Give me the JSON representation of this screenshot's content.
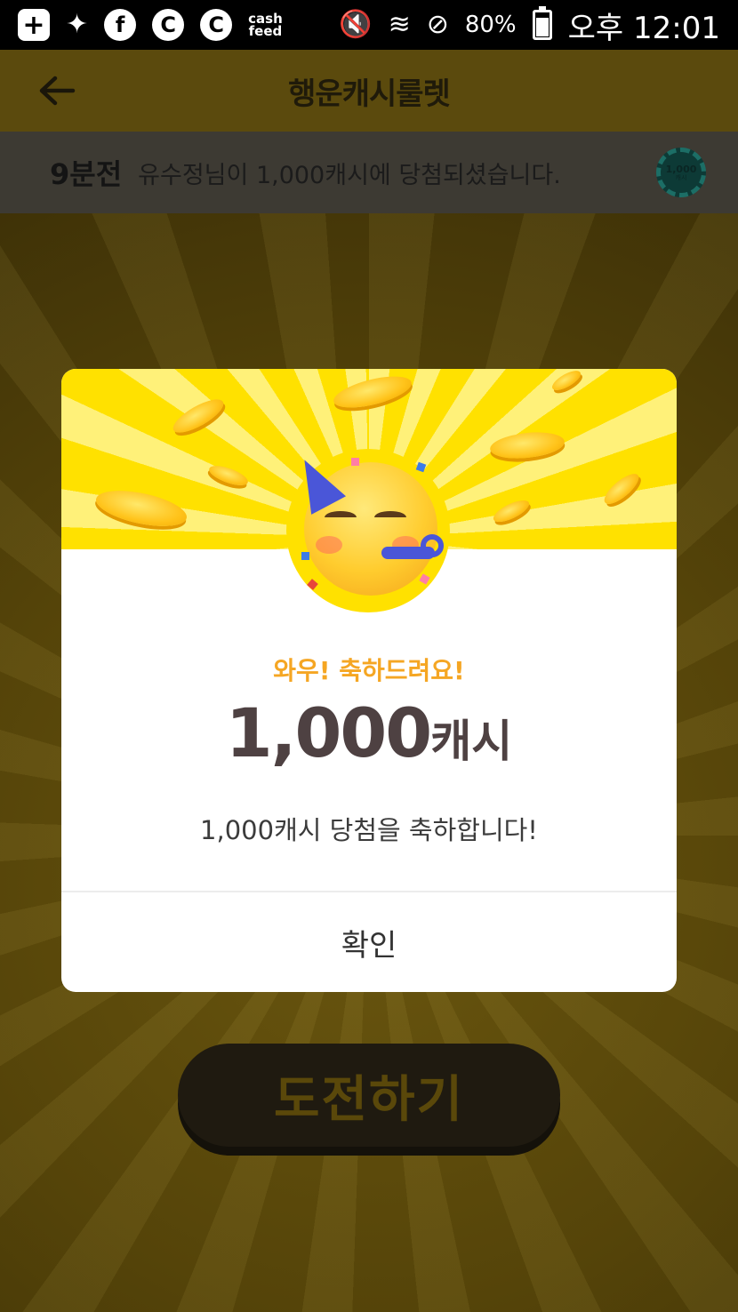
{
  "status_bar": {
    "cashfeed_top": "cash",
    "cashfeed_bottom": "feed",
    "battery_percent": "80%",
    "battery_level": 0.8,
    "ampm": "오후",
    "time": "12:01"
  },
  "header": {
    "title": "행운캐시룰렛"
  },
  "ticker": {
    "time_ago": "9분전",
    "message": "유수정님이 1,000캐시에 당첨되셨습니다.",
    "coin_value": "1,000",
    "coin_unit": "캐시"
  },
  "modal": {
    "subtitle": "와우! 축하드려요!",
    "amount_number": "1,000",
    "amount_unit": "캐시",
    "message": "1,000캐시 당첨을 축하합니다!",
    "confirm_label": "확인"
  },
  "game": {
    "challenge_label": "도전하기"
  },
  "colors": {
    "accent_yellow": "#ffe100",
    "subtitle_orange": "#f5a623",
    "amount_text": "#4e4142"
  }
}
